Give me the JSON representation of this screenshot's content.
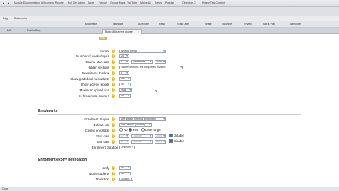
{
  "browser": {
    "menu": [
      "Moodle Documentation",
      "Welcome to Moodle!",
      "Full Site Admin",
      "Apple",
      "Yahoo!",
      "Google Maps",
      "YouTube",
      "Wikipedia",
      "News",
      "Popular",
      "Objective-C",
      "Please Test Content"
    ],
    "url": "http://localhost:8888/moodle19/course/edit.php?category=1",
    "bookmarks": [
      "Bookmarks",
      "Highlight",
      "Subscribe",
      "Read",
      "Read Later",
      "Share",
      "Stumble",
      "Review",
      "Add a Post",
      "Subscribe"
    ],
    "bookmarks_left": [
      "Digg",
      "Bookmarks"
    ],
    "tabs": [
      "Edit",
      "Post to Blog"
    ],
    "active_tab": "Book: Add a new course",
    "icons": [
      "back-arrow-icon",
      "forward-arrow-icon",
      "reload-icon",
      "home-icon",
      "search-icon",
      "close-icon"
    ]
  },
  "page": {
    "badge": "ONE",
    "general": {
      "format": {
        "label": "Format",
        "value": "Weekly format"
      },
      "numsections": {
        "label": "Number of weeks/topics",
        "value": "10"
      },
      "startdate": {
        "label": "Course start date",
        "day": "6",
        "month": "September",
        "year": "2009"
      },
      "hiddensections": {
        "label": "Hidden sections",
        "value": "Hidden sections are completely invisible"
      },
      "newsitems": {
        "label": "News items to show",
        "value": "5"
      },
      "showgrades": {
        "label": "Show gradebook to students",
        "value": "Yes"
      },
      "showreports": {
        "label": "Show activity reports",
        "value": "No"
      },
      "maxbytes": {
        "label": "Maximum upload size",
        "value": "2MB"
      },
      "metacourse": {
        "label": "Is this a meta course?",
        "value": "No"
      }
    },
    "enrolments": {
      "title": "Enrolments",
      "plugins": {
        "label": "Enrolment Plugins",
        "value": "Site default (internal enrolment)"
      },
      "defaultrole": {
        "label": "Default role",
        "value": "Site Default (Student)"
      },
      "enrollable": {
        "label": "Course enrollable",
        "options": [
          "No",
          "Yes",
          "Date range"
        ],
        "selected": "Yes"
      },
      "startdate": {
        "label": "Start date",
        "day": "17",
        "month": "October",
        "year": "2009",
        "disable": "Disable"
      },
      "enddate": {
        "label": "End date",
        "day": "17",
        "month": "October",
        "year": "2009",
        "disable": "Disable"
      },
      "duration": {
        "label": "Enrolment duration",
        "value": "Unlimited"
      }
    },
    "expiry": {
      "title": "Enrolment expiry notification",
      "notify": {
        "label": "Notify",
        "value": "No"
      },
      "notifystudents": {
        "label": "Notify students",
        "value": "No"
      },
      "threshold": {
        "label": "Threshold",
        "value": "10 days"
      }
    }
  },
  "status": {
    "text": "Done"
  }
}
